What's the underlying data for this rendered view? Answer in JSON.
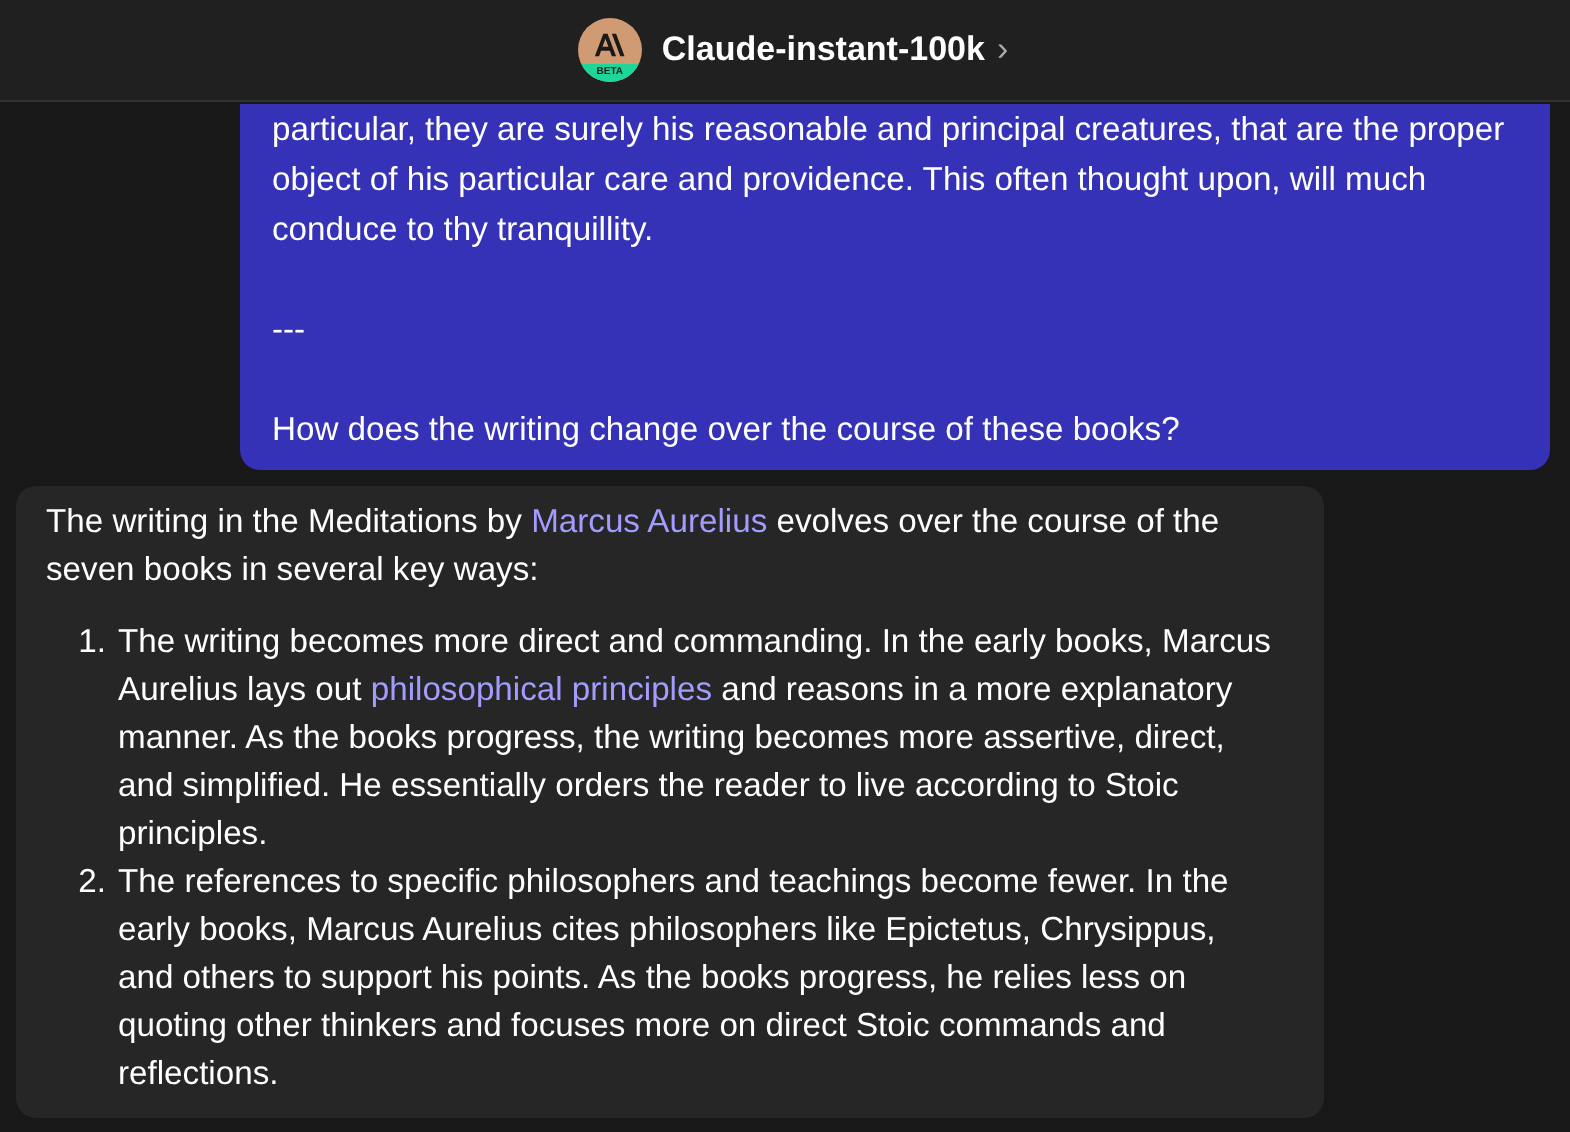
{
  "header": {
    "model_name": "Claude-instant-100k",
    "chevron": "›",
    "avatar_badge": "BETA"
  },
  "messages": [
    {
      "kind": "user",
      "paragraphs": [
        [
          {
            "text": "particular, they are surely his reasonable and principal creatures, that are the proper object of his particular care and providence. This often thought upon, will much conduce to thy tranquillity."
          }
        ],
        [
          {
            "text": "---"
          }
        ],
        [
          {
            "text": "How does the writing change over the course of these books?"
          }
        ]
      ]
    },
    {
      "kind": "assistant",
      "paragraphs": [
        [
          {
            "text": "The writing in the Meditations by "
          },
          {
            "text": "Marcus Aurelius",
            "kind": "link"
          },
          {
            "text": " evolves over the course of the seven books in several key ways:"
          }
        ]
      ],
      "list": [
        {
          "number": "1.",
          "segments": [
            {
              "text": "The writing becomes more direct and commanding. In the early books, Marcus Aurelius lays out "
            },
            {
              "text": "philosophical principles",
              "kind": "link"
            },
            {
              "text": " and reasons in a more explanatory manner. As the books progress, the writing becomes more assertive, direct, and simplified. He essentially orders the reader to live according to Stoic principles."
            }
          ]
        },
        {
          "number": "2.",
          "segments": [
            {
              "text": "The references to specific philosophers and teachings become fewer. In the early books, Marcus Aurelius cites philosophers like Epictetus, Chrysippus, and others to support his points. As the books progress, he relies less on quoting other thinkers and focuses more on direct Stoic commands and reflections."
            }
          ]
        }
      ]
    }
  ]
}
